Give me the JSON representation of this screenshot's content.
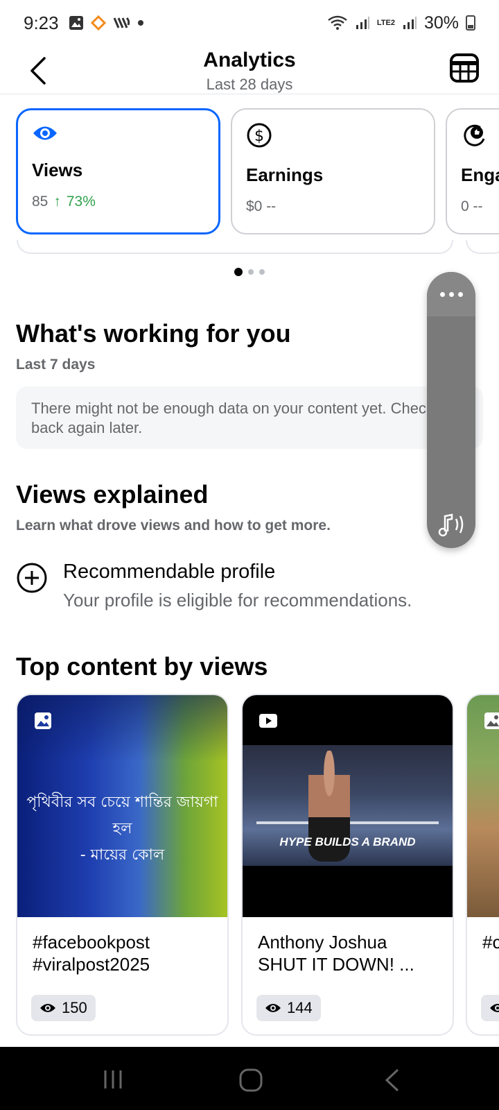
{
  "status_bar": {
    "time": "9:23",
    "battery": "30%",
    "network": "LTE2"
  },
  "header": {
    "title": "Analytics",
    "subtitle": "Last 28 days"
  },
  "metrics": [
    {
      "label": "Views",
      "value": "85",
      "change": "73%",
      "icon": "eye-icon",
      "active": true
    },
    {
      "label": "Earnings",
      "value": "$0 --",
      "change": "",
      "icon": "dollar-icon",
      "active": false
    },
    {
      "label": "Enga",
      "value": "0 --",
      "change": "",
      "icon": "engagement-icon",
      "active": false
    }
  ],
  "working": {
    "title": "What's working for you",
    "subtitle": "Last 7 days",
    "message": "There might not be enough data on your content yet. Check back again later."
  },
  "views_explained": {
    "title": "Views explained",
    "subtitle": "Learn what drove views and how to get more.",
    "item_title": "Recommendable profile",
    "item_subtitle": "Your profile is eligible for recommendations."
  },
  "top_content": {
    "title": "Top content by views",
    "items": [
      {
        "type": "photo",
        "text_line1": "#facebookpost",
        "text_line2": "#viralpost2025",
        "views": "150",
        "thumb_text_line1": "পৃথিবীর সব চেয়ে শান্তির জায়গা হল",
        "thumb_text_line2": "- মায়ের কোল"
      },
      {
        "type": "video",
        "text_line1": "Anthony Joshua",
        "text_line2": "SHUT IT DOWN! ...",
        "views": "144",
        "thumb_caption": "HYPE BUILDS A BRAND"
      },
      {
        "type": "photo",
        "text_line1": "#c",
        "text_line2": "",
        "views": ""
      }
    ]
  }
}
